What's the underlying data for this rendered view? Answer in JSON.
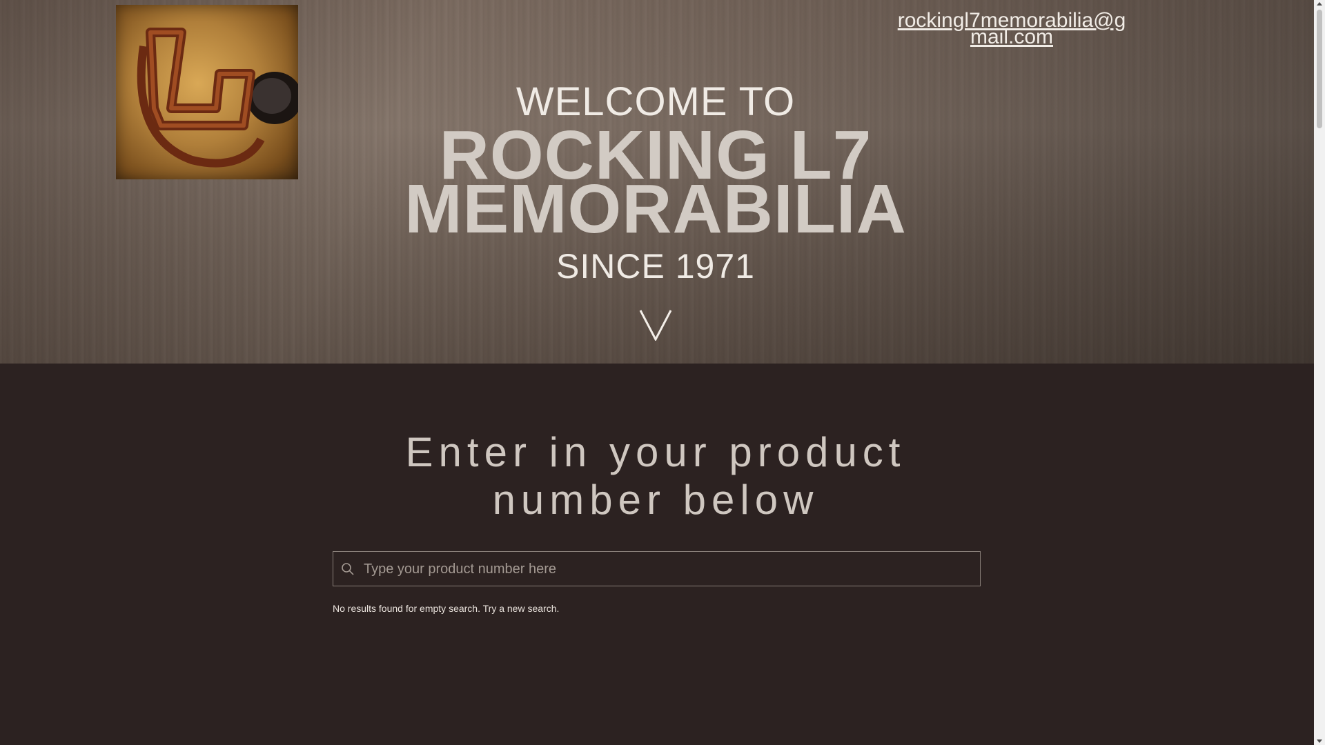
{
  "header": {
    "logo_name": "rocking-l7-brand-logo",
    "email": "rockingl7memorabilia@gmail.com"
  },
  "hero": {
    "welcome": "WELCOME TO",
    "brand_line1": "ROCKING L7",
    "brand_line2": "MEMORABILIA",
    "since": "SINCE 1971",
    "scroll_icon": "chevron-down-icon"
  },
  "search": {
    "heading_line1": "Enter in your product",
    "heading_line2": "number below",
    "placeholder": "Type your product number here",
    "value": "",
    "icon": "search-icon",
    "status": "No results found for empty search. Try a new search."
  },
  "colors": {
    "page_background": "#2c2221",
    "hero_text": "#f0ebe5",
    "brand_text": "#d2cbc4",
    "heading_text": "#cfc7c0"
  }
}
